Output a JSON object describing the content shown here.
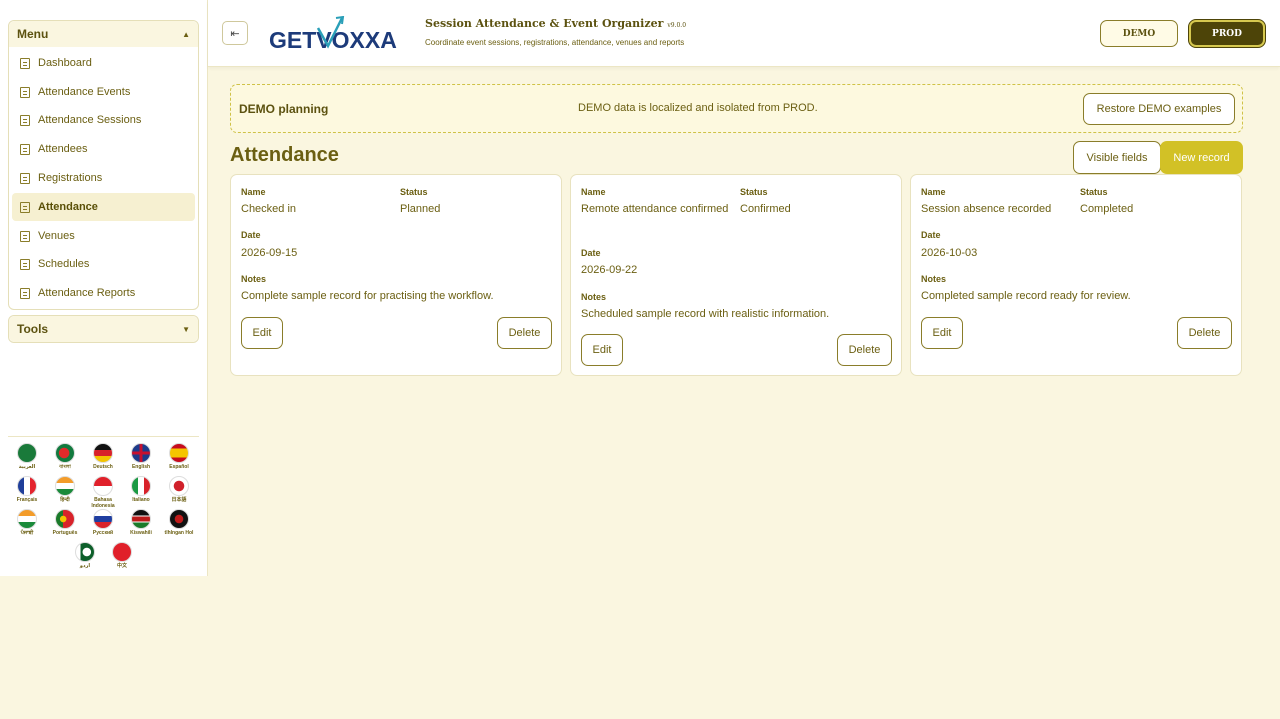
{
  "sidebar": {
    "menu_title": "Menu",
    "tools_title": "Tools",
    "items": [
      {
        "label": "Dashboard"
      },
      {
        "label": "Attendance Events"
      },
      {
        "label": "Attendance Sessions"
      },
      {
        "label": "Attendees"
      },
      {
        "label": "Registrations"
      },
      {
        "label": "Attendance"
      },
      {
        "label": "Venues"
      },
      {
        "label": "Schedules"
      },
      {
        "label": "Attendance Reports"
      }
    ],
    "active_item": "Attendance",
    "languages": [
      {
        "label": "العربية"
      },
      {
        "label": "বাংলা"
      },
      {
        "label": "Deutsch"
      },
      {
        "label": "English"
      },
      {
        "label": "Español"
      },
      {
        "label": "Français"
      },
      {
        "label": "हिन्दी"
      },
      {
        "label": "Bahasa Indonesia"
      },
      {
        "label": "Italiano"
      },
      {
        "label": "日本語"
      },
      {
        "label": "ਪੰਜਾਬੀ"
      },
      {
        "label": "Português"
      },
      {
        "label": "Русский"
      },
      {
        "label": "Kiswahili"
      },
      {
        "label": "tlhIngan Hol"
      },
      {
        "label": "اردو"
      },
      {
        "label": "中文"
      }
    ]
  },
  "header": {
    "logo_text": "GETVOXXA",
    "title": "Session Attendance & Event Organizer",
    "version": "v9.0.0",
    "subtitle": "Coordinate event sessions, registrations, attendance, venues and reports",
    "demo_label": "DEMO",
    "prod_label": "PROD"
  },
  "banner": {
    "title": "DEMO planning",
    "message": "DEMO data is localized and isolated from PROD.",
    "restore_label": "Restore DEMO examples"
  },
  "page": {
    "title": "Attendance",
    "visible_fields_label": "Visible fields",
    "new_record_label": "New record"
  },
  "labels": {
    "name": "Name",
    "status": "Status",
    "date": "Date",
    "notes": "Notes",
    "edit": "Edit",
    "delete": "Delete"
  },
  "records": [
    {
      "name": "Checked in",
      "status": "Planned",
      "date": "2026-09-15",
      "notes": "Complete sample record for practising the workflow."
    },
    {
      "name": "Remote attendance confirmed",
      "status": "Confirmed",
      "date": "2026-09-22",
      "notes": "Scheduled sample record with realistic information."
    },
    {
      "name": "Session absence recorded",
      "status": "Completed",
      "date": "2026-10-03",
      "notes": "Completed sample record ready for review."
    }
  ],
  "colors": {
    "background": "#faf6e0",
    "accent": "#d2c126",
    "prod": "#4d4408",
    "text": "#6b5f12"
  }
}
